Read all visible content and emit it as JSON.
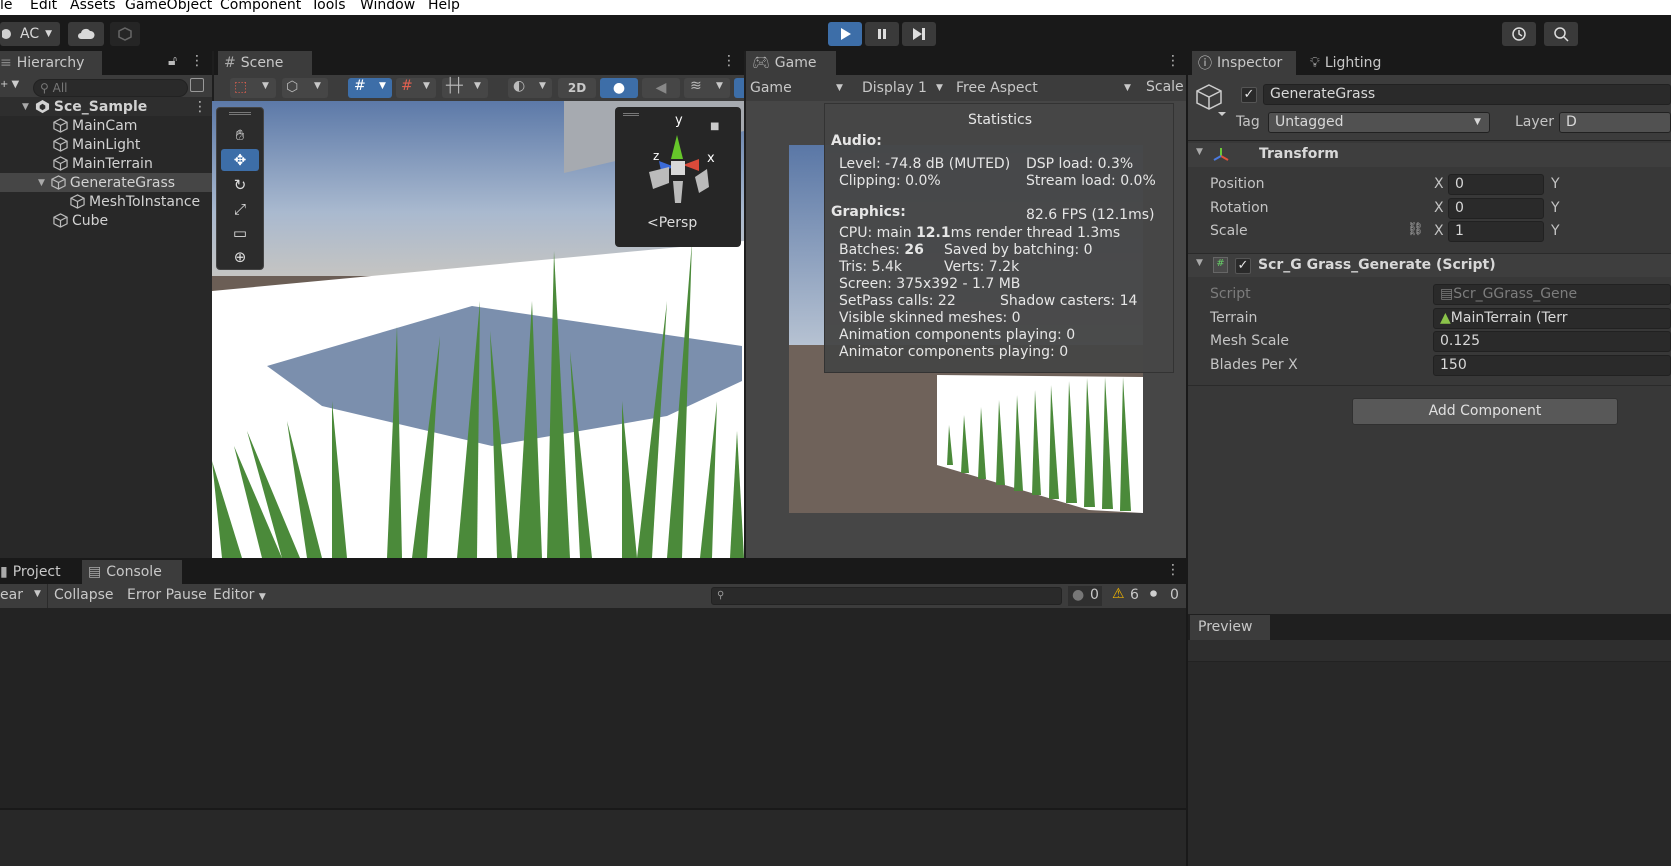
{
  "menu": {
    "file": "le",
    "edit": "Edit",
    "assets": "Assets",
    "gameobject": "GameObject",
    "component": "Component",
    "tools": "Tools",
    "window": "Window",
    "help": "Help"
  },
  "toolbar": {
    "account": "AC"
  },
  "hierarchy": {
    "tab": "Hierarchy",
    "search_placeholder": "All",
    "scene": "Sce_Sample",
    "items": [
      {
        "label": "MainCam"
      },
      {
        "label": "MainLight"
      },
      {
        "label": "MainTerrain"
      },
      {
        "label": "GenerateGrass"
      },
      {
        "label": "MeshToInstance"
      },
      {
        "label": "Cube"
      }
    ]
  },
  "scene": {
    "tab": "Scene",
    "btn_2d": "2D",
    "persp": "Persp",
    "gizmo": {
      "y": "y",
      "x": "x",
      "z": "z"
    }
  },
  "game": {
    "tab": "Game",
    "mode": "Game",
    "display": "Display 1",
    "aspect": "Free Aspect",
    "scale": "Scale"
  },
  "stats": {
    "title": "Statistics",
    "audio_header": "Audio:",
    "level": "Level: -74.8 dB (MUTED)",
    "clipping": "Clipping: 0.0%",
    "dsp": "DSP load: 0.3%",
    "stream": "Stream load: 0.0%",
    "graphics_header": "Graphics:",
    "fps": "82.6 FPS (12.1ms)",
    "cpu_pre": "CPU: main ",
    "cpu_main": "12.1",
    "cpu_post": "ms  render thread 1.3ms",
    "batches_pre": "Batches: ",
    "batches": "26",
    "saved": "Saved by batching: 0",
    "tris": "Tris: 5.4k",
    "verts": "Verts: 7.2k",
    "screen": "Screen: 375x392 - 1.7 MB",
    "setpass": "SetPass calls: 22",
    "shadow": "Shadow casters: 14",
    "skinned": "Visible skinned meshes: 0",
    "anim": "Animation components playing: 0",
    "animator": "Animator components playing: 0"
  },
  "inspector": {
    "tab": "Inspector",
    "lighting_tab": "Lighting",
    "object_name": "GenerateGrass",
    "tag_label": "Tag",
    "tag_value": "Untagged",
    "layer_label": "Layer",
    "layer_value": "D",
    "transform": {
      "title": "Transform",
      "position_label": "Position",
      "position_x": "0",
      "rotation_label": "Rotation",
      "rotation_x": "0",
      "scale_label": "Scale",
      "scale_x": "1",
      "x": "X",
      "y": "Y"
    },
    "script_comp": {
      "title": "Scr_G Grass_Generate (Script)",
      "script_label": "Script",
      "script_value": "Scr_GGrass_Gene",
      "terrain_label": "Terrain",
      "terrain_value": "MainTerrain (Terr",
      "mesh_scale_label": "Mesh Scale",
      "mesh_scale_value": "0.125",
      "blades_label": "Blades Per X",
      "blades_value": "150"
    },
    "add_component": "Add Component",
    "preview": "Preview"
  },
  "bottom": {
    "project_tab": "Project",
    "console_tab": "Console",
    "clear": "ear",
    "collapse": "Collapse",
    "error_pause": "Error Pause",
    "editor": "Editor",
    "info_count": "0",
    "warn_count": "6",
    "error_count": "0"
  },
  "colors": {
    "accent": "#3d6ea8",
    "selected": "#464646",
    "warning": "#f0b400"
  }
}
